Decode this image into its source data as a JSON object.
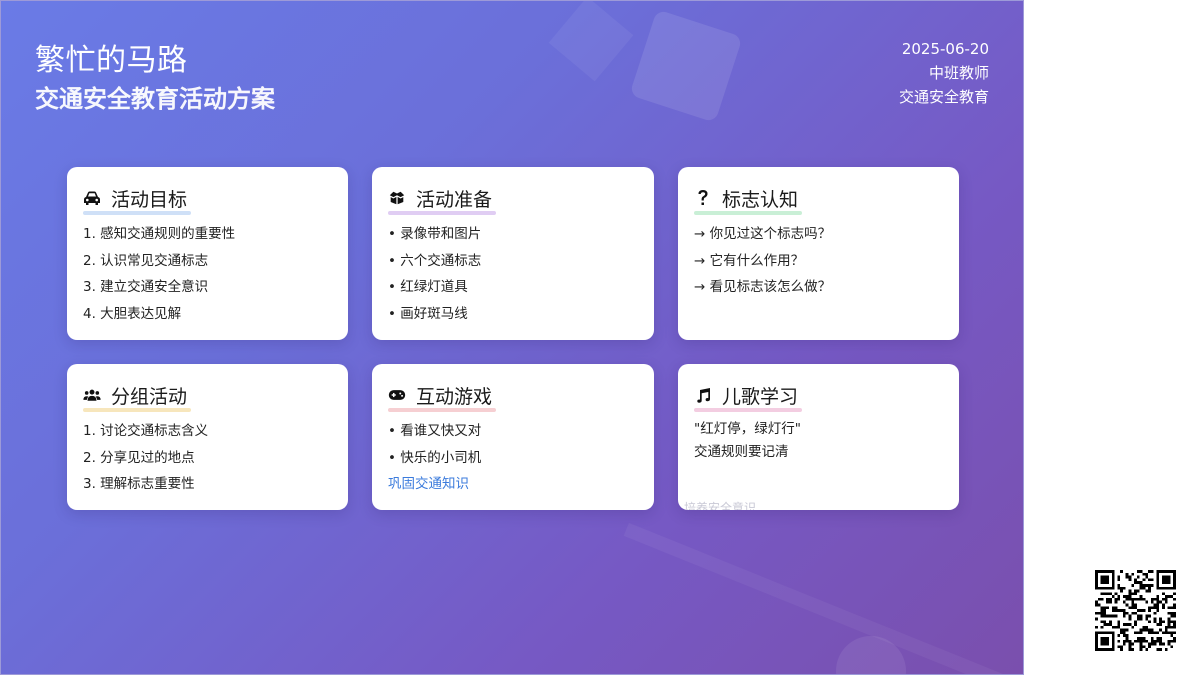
{
  "header": {
    "title": "繁忙的马路",
    "subtitle": "交通安全教育活动方案",
    "date": "2025-06-20",
    "teacher": "中班教师",
    "topic": "交通安全教育"
  },
  "cards": [
    {
      "icon": "car-icon",
      "title": "活动目标",
      "accent": "#cfe0f7",
      "items": [
        "1. 感知交通规则的重要性",
        "2. 认识常见交通标志",
        "3. 建立交通安全意识",
        "4. 大胆表达见解"
      ]
    },
    {
      "icon": "box-icon",
      "title": "活动准备",
      "accent": "#e0cdf3",
      "items": [
        "• 录像带和图片",
        "• 六个交通标志",
        "• 红绿灯道具",
        "• 画好斑马线"
      ]
    },
    {
      "icon": "question-icon",
      "title": "标志认知",
      "accent": "#c9efd6",
      "items": [
        "→ 你见过这个标志吗？",
        "→ 它有什么作用？",
        "→ 看见标志该怎么做？"
      ]
    },
    {
      "icon": "users-icon",
      "title": "分组活动",
      "accent": "#f7e6bc",
      "items": [
        "1. 讨论交通标志含义",
        "2. 分享见过的地点",
        "3. 理解标志重要性"
      ]
    },
    {
      "icon": "gamepad-icon",
      "title": "互动游戏",
      "accent": "#f6cfd2",
      "items": [
        "• 看谁又快又对",
        "• 快乐的小司机"
      ],
      "link": "巩固交通知识"
    },
    {
      "icon": "music-icon",
      "title": "儿歌学习",
      "accent": "#f3cde1",
      "lines": [
        "\"红灯停，绿灯行\"",
        "交通规则要记清"
      ],
      "ghost": "培养安全意识"
    }
  ]
}
